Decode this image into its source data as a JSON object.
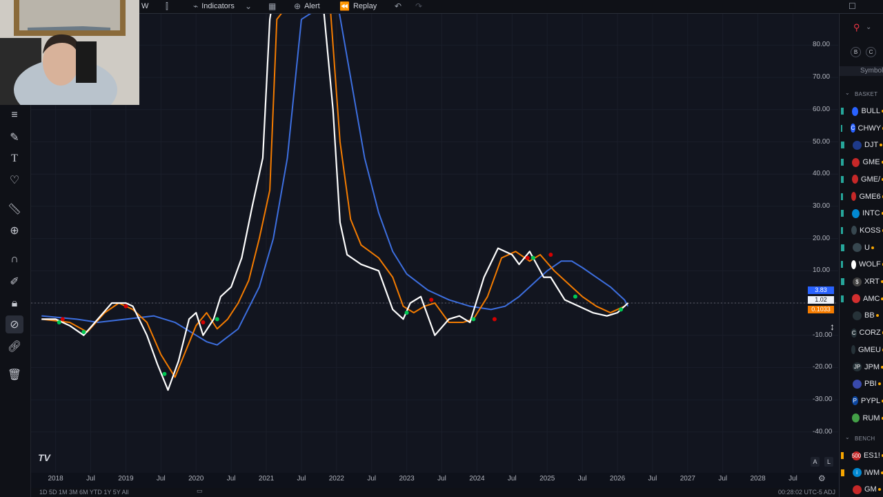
{
  "toolbar": {
    "partial_left": "W",
    "indicators_label": "Indicators",
    "alert_label": "Alert",
    "replay_label": "Replay"
  },
  "price_axis": {
    "labels": [
      "80.00",
      "70.00",
      "60.00",
      "50.00",
      "40.00",
      "30.00",
      "20.00",
      "10.00",
      "0",
      "-10.00",
      "-20.00",
      "-30.00",
      "-40.00"
    ],
    "badges": {
      "white_value": "3.83",
      "blue_value": "1.02",
      "orange_value": "0.1033"
    }
  },
  "time_axis": {
    "labels": [
      "2018",
      "Jul",
      "2019",
      "Jul",
      "2020",
      "Jul",
      "2021",
      "Jul",
      "2022",
      "Jul",
      "2023",
      "Jul",
      "2024",
      "Jul",
      "2025",
      "Jul",
      "2026",
      "Jul",
      "2027",
      "Jul",
      "2028",
      "Jul"
    ]
  },
  "axis_buttons": {
    "auto": "A",
    "log": "L"
  },
  "brand_logo": "TV",
  "watchlist": {
    "header": "Symbol",
    "section_baskets": "BASKET",
    "section_bench": "BENCH",
    "top_buttons": [
      "B",
      "C"
    ],
    "rows": [
      {
        "symbol": "BULL",
        "flag": "#26a69a",
        "logo_color": "#2962ff",
        "logo_text": ""
      },
      {
        "symbol": "CHWY",
        "flag": "#26a69a",
        "logo_color": "#2962ff",
        "logo_text": "C"
      },
      {
        "symbol": "DJT",
        "flag": "#26a69a",
        "logo_color": "#1e3a8a",
        "logo_text": ""
      },
      {
        "symbol": "GME",
        "flag": "#26a69a",
        "logo_color": "#c62828",
        "logo_text": ""
      },
      {
        "symbol": "GME/",
        "flag": "#26a69a",
        "logo_color": "#c62828",
        "logo_text": ""
      },
      {
        "symbol": "GME6",
        "flag": "#26a69a",
        "logo_color": "#c62828",
        "logo_text": ""
      },
      {
        "symbol": "INTC",
        "flag": "#26a69a",
        "logo_color": "#0288d1",
        "logo_text": ""
      },
      {
        "symbol": "KOSS",
        "flag": "#26a69a",
        "logo_color": "#37474f",
        "logo_text": ""
      },
      {
        "symbol": "U",
        "flag": "#26a69a",
        "logo_color": "#37474f",
        "logo_text": ""
      },
      {
        "symbol": "WOLF",
        "flag": "#26a69a",
        "logo_color": "#ffffff",
        "logo_text": ""
      },
      {
        "symbol": "XRT",
        "flag": "#26a69a",
        "logo_color": "#424242",
        "logo_text": "$"
      },
      {
        "symbol": "AMC",
        "flag": "#26a69a",
        "logo_color": "#d32f2f",
        "logo_text": ""
      },
      {
        "symbol": "BB",
        "flag": "",
        "logo_color": "#263238",
        "logo_text": ""
      },
      {
        "symbol": "CORZ",
        "flag": "",
        "logo_color": "#263238",
        "logo_text": "C"
      },
      {
        "symbol": "GMEU",
        "flag": "",
        "logo_color": "#263238",
        "logo_text": ""
      },
      {
        "symbol": "JPM",
        "flag": "",
        "logo_color": "#263238",
        "logo_text": "JP"
      },
      {
        "symbol": "PBI",
        "flag": "",
        "logo_color": "#3949ab",
        "logo_text": ""
      },
      {
        "symbol": "PYPL",
        "flag": "",
        "logo_color": "#0d47a1",
        "logo_text": "P"
      },
      {
        "symbol": "RUM",
        "flag": "",
        "logo_color": "#43a047",
        "logo_text": ""
      }
    ],
    "bench_rows": [
      {
        "symbol": "ES1!",
        "flag": "#f7a600",
        "logo_color": "#c62828",
        "logo_text": "500"
      },
      {
        "symbol": "IWM",
        "flag": "#f7a600",
        "logo_color": "#0288d1",
        "logo_text": "i"
      },
      {
        "symbol": "GM",
        "flag": "",
        "logo_color": "#c62828",
        "logo_text": ""
      }
    ]
  },
  "bottom_bar": {
    "left": "1D 5D 1M 3M 6M YTD 1Y 5Y All",
    "right": "00:28:02 UTC-5   ADJ"
  },
  "chart_data": {
    "type": "line",
    "xlim": [
      2017.8,
      2028.6
    ],
    "ylim": [
      -45,
      88
    ],
    "series": [
      {
        "color": "#ffffff",
        "x": [
          2017.8,
          2018.0,
          2018.2,
          2018.4,
          2018.6,
          2018.8,
          2019.0,
          2019.1,
          2019.3,
          2019.45,
          2019.6,
          2019.75,
          2019.9,
          2020.0,
          2020.1,
          2020.25,
          2020.35,
          2020.5,
          2020.65,
          2020.8,
          2020.95,
          2021.05,
          2021.1,
          2021.4,
          2021.6,
          2021.8,
          2021.95,
          2022.05,
          2022.15,
          2022.35,
          2022.6,
          2022.8,
          2022.95,
          2023.05,
          2023.2,
          2023.4,
          2023.6,
          2023.75,
          2023.9,
          2024.1,
          2024.3,
          2024.5,
          2024.6,
          2024.75,
          2024.95,
          2025.05,
          2025.25,
          2025.45,
          2025.65,
          2025.85,
          2026.0,
          2026.15
        ],
        "y": [
          -5,
          -5,
          -7,
          -10,
          -5,
          0,
          0,
          -1,
          -10,
          -19,
          -27,
          -18,
          -5,
          -3,
          -10,
          -5,
          2,
          5,
          14,
          30,
          45,
          88,
          95,
          95,
          95,
          95,
          60,
          25,
          15,
          12,
          10,
          -2,
          -5,
          0,
          2,
          -10,
          -5,
          -4,
          -6,
          8,
          17,
          15,
          12,
          16,
          8,
          8,
          1,
          -1,
          -3,
          -4,
          -3,
          0
        ]
      },
      {
        "color": "#f57c00",
        "x": [
          2017.8,
          2018.2,
          2018.45,
          2018.7,
          2018.9,
          2019.1,
          2019.3,
          2019.5,
          2019.7,
          2019.85,
          2020.0,
          2020.15,
          2020.3,
          2020.45,
          2020.6,
          2020.75,
          2020.9,
          2021.05,
          2021.15,
          2021.4,
          2021.7,
          2021.9,
          2022.05,
          2022.2,
          2022.35,
          2022.6,
          2022.8,
          2022.95,
          2023.1,
          2023.25,
          2023.4,
          2023.6,
          2023.8,
          2023.95,
          2024.15,
          2024.35,
          2024.55,
          2024.75,
          2024.9,
          2025.1,
          2025.3,
          2025.5,
          2025.7,
          2025.9,
          2026.1,
          2026.15
        ],
        "y": [
          -5,
          -6,
          -9,
          -3,
          0,
          -2,
          -6,
          -16,
          -23,
          -15,
          -7,
          -3,
          -8,
          -5,
          0,
          7,
          20,
          35,
          88,
          95,
          95,
          95,
          50,
          26,
          18,
          14,
          8,
          -1,
          -3,
          -1,
          0,
          -6,
          -6,
          -5,
          2,
          14,
          16,
          13,
          15,
          10,
          6,
          2,
          -1,
          -3,
          -1,
          0
        ]
      },
      {
        "color": "#3d6fe0",
        "x": [
          2017.8,
          2018.3,
          2018.6,
          2019.0,
          2019.4,
          2019.7,
          2020.0,
          2020.15,
          2020.3,
          2020.6,
          2020.9,
          2021.1,
          2021.3,
          2021.5,
          2022.0,
          2022.2,
          2022.4,
          2022.6,
          2022.8,
          2023.0,
          2023.3,
          2023.6,
          2023.9,
          2024.2,
          2024.4,
          2024.6,
          2024.8,
          2025.0,
          2025.2,
          2025.35,
          2025.5,
          2025.7,
          2025.9,
          2026.1,
          2026.15
        ],
        "y": [
          -4,
          -5,
          -6,
          -5,
          -4,
          -6,
          -10,
          -12,
          -13,
          -8,
          5,
          20,
          45,
          88,
          95,
          70,
          45,
          28,
          16,
          9,
          4,
          1,
          -1,
          -2,
          -1,
          2,
          6,
          10,
          13,
          13,
          11,
          8,
          5,
          1,
          -1
        ]
      }
    ],
    "markers": [
      {
        "x": 2018.05,
        "y": -6,
        "color": "#00c853"
      },
      {
        "x": 2018.1,
        "y": -5,
        "color": "#d50000"
      },
      {
        "x": 2018.4,
        "y": -9,
        "color": "#00c853"
      },
      {
        "x": 2019.0,
        "y": -1,
        "color": "#d50000"
      },
      {
        "x": 2019.55,
        "y": -22,
        "color": "#00c853"
      },
      {
        "x": 2020.1,
        "y": -6,
        "color": "#d50000"
      },
      {
        "x": 2020.3,
        "y": -5,
        "color": "#00c853"
      },
      {
        "x": 2023.0,
        "y": -3,
        "color": "#00c853"
      },
      {
        "x": 2023.35,
        "y": 1,
        "color": "#d50000"
      },
      {
        "x": 2023.95,
        "y": -5,
        "color": "#00c853"
      },
      {
        "x": 2024.25,
        "y": -5,
        "color": "#d50000"
      },
      {
        "x": 2024.72,
        "y": 14,
        "color": "#d50000"
      },
      {
        "x": 2024.8,
        "y": 14,
        "color": "#00c853"
      },
      {
        "x": 2025.05,
        "y": 15,
        "color": "#d50000"
      },
      {
        "x": 2025.4,
        "y": 2,
        "color": "#00c853"
      },
      {
        "x": 2026.05,
        "y": -2,
        "color": "#00c853"
      }
    ],
    "zero_line": 0
  }
}
